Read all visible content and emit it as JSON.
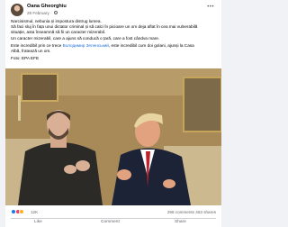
{
  "post": {
    "author": "Oana Gheorghiu",
    "date": "28 February",
    "paragraph1": [
      "Narcisismul, nebunia și impostura distrug lumea.",
      "Să faci sluj în fața unui dictator criminal și să calci în picioare un om deja aflat în cea mai vulnerabilă",
      "situație, asta înseamnă să fii un caracter mizerabil.",
      "Un caracter mizerabil, care a ajuns să conducă o țară, care a fost cândva mare."
    ],
    "paragraph2_prefix": "Este incredibil prin ce trece ",
    "paragraph2_link": "Володимир Зеленський",
    "paragraph2_suffix": ", este incredibil cum doi golani, ajunși la Casa",
    "paragraph2_line2": "Albă, fratează un om.",
    "photo_credit": "Foto: EPA EFE"
  },
  "stats": {
    "reaction_count": "12K",
    "comments": "298 comments",
    "shares": "453 shares"
  },
  "actions": {
    "like": "Like",
    "comment": "Comment",
    "share": "Share"
  },
  "icons": [
    "avatar",
    "globe-icon",
    "more-icon",
    "like-reaction-icon",
    "love-reaction-icon",
    "haha-reaction-icon"
  ]
}
